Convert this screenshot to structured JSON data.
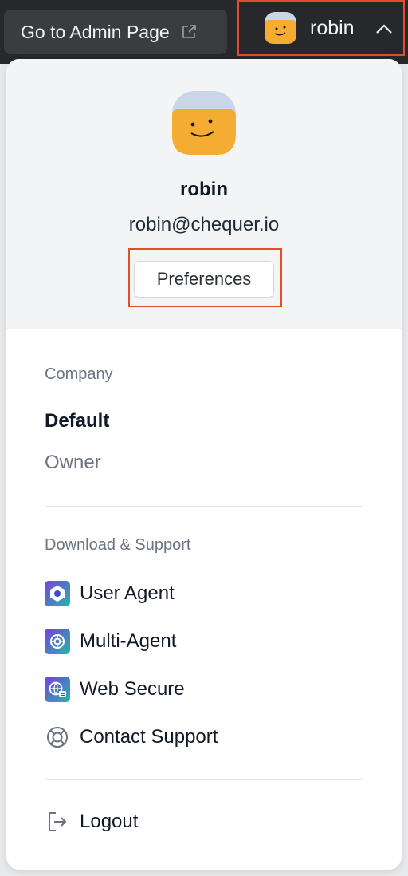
{
  "topbar": {
    "admin_label": "Go to Admin Page",
    "admin_icon": "external-link-icon",
    "user_name": "robin",
    "chevron_icon": "chevron-up-icon"
  },
  "profile": {
    "name": "robin",
    "email": "robin@chequer.io",
    "preferences_label": "Preferences"
  },
  "company": {
    "section_label": "Company",
    "name": "Default",
    "role": "Owner"
  },
  "support": {
    "section_label": "Download & Support",
    "items": [
      {
        "label": "User Agent",
        "icon": "user-agent-icon"
      },
      {
        "label": "Multi-Agent",
        "icon": "multi-agent-icon"
      },
      {
        "label": "Web Secure",
        "icon": "web-secure-icon"
      },
      {
        "label": "Contact Support",
        "icon": "lifebuoy-icon"
      }
    ]
  },
  "logout": {
    "label": "Logout",
    "icon": "logout-icon"
  },
  "colors": {
    "highlight": "#e04e2a",
    "avatar": "#f4ac33",
    "topbar": "#27282b"
  }
}
